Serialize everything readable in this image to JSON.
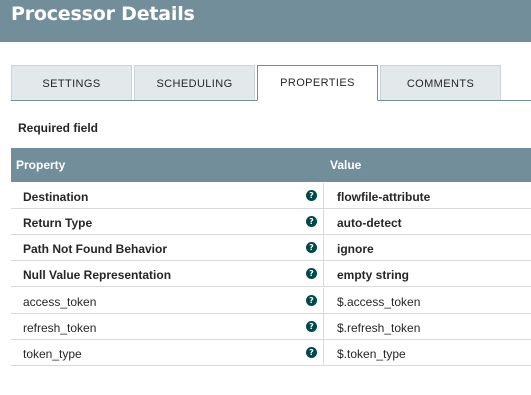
{
  "dialog": {
    "title": "Processor Details"
  },
  "tabs": [
    {
      "label": "SETTINGS"
    },
    {
      "label": "SCHEDULING"
    },
    {
      "label": "PROPERTIES"
    },
    {
      "label": "COMMENTS"
    }
  ],
  "active_tab": "PROPERTIES",
  "required_note": "Required field",
  "grid": {
    "columns": {
      "property": "Property",
      "value": "Value"
    },
    "rows": [
      {
        "name": "Destination",
        "value": "flowfile-attribute",
        "required": true,
        "help_icon": "help-icon"
      },
      {
        "name": "Return Type",
        "value": "auto-detect",
        "required": true,
        "help_icon": "help-icon"
      },
      {
        "name": "Path Not Found Behavior",
        "value": "ignore",
        "required": true,
        "help_icon": "help-icon"
      },
      {
        "name": "Null Value Representation",
        "value": "empty string",
        "required": true,
        "help_icon": "help-icon"
      },
      {
        "name": "access_token",
        "value": "$.access_token",
        "required": false,
        "help_icon": "help-icon"
      },
      {
        "name": "refresh_token",
        "value": "$.refresh_token",
        "required": false,
        "help_icon": "help-icon"
      },
      {
        "name": "token_type",
        "value": "$.token_type",
        "required": false,
        "help_icon": "help-icon"
      }
    ]
  },
  "colors": {
    "header": "#728e9b",
    "tab_inactive": "#e3e8eb",
    "help_icon": "#004849"
  }
}
